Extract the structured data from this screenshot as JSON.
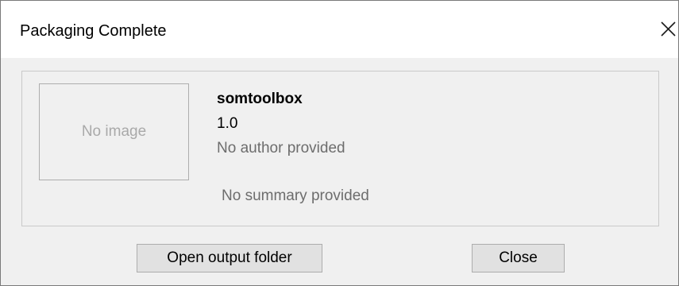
{
  "window": {
    "title": "Packaging Complete",
    "close_icon": "close-icon"
  },
  "package": {
    "image_placeholder": "No image",
    "name": "somtoolbox",
    "version": "1.0",
    "author": "No author provided",
    "summary": "No summary provided"
  },
  "buttons": {
    "open_output_folder": "Open output folder",
    "close": "Close"
  },
  "colors": {
    "titlebar_bg": "#ffffff",
    "dialog_bg": "#f0f0f0",
    "muted_text": "#6d6d6d",
    "placeholder_text": "#a9a9a9",
    "button_bg": "#e1e1e1",
    "button_border": "#adadad"
  }
}
